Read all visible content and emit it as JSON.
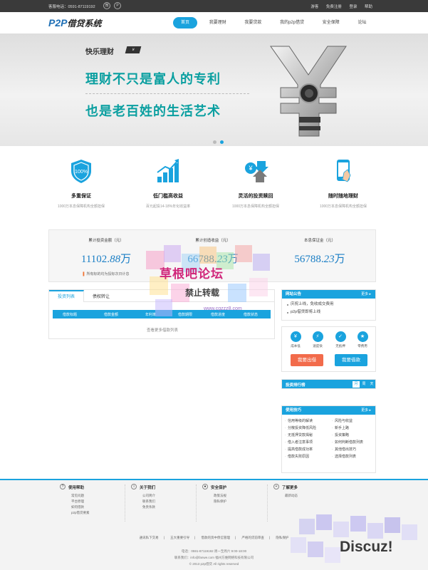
{
  "topbar": {
    "phone": "客服电话：0591-87119192",
    "social": [
      "微",
      "P"
    ],
    "links": [
      "游客",
      "免费注册",
      "登录",
      "帮助"
    ]
  },
  "nav": {
    "logo_latin": "P2P",
    "logo_cn": "借贷系统",
    "items": [
      "首页",
      "我要理财",
      "我要贷款",
      "我的p2p借贷",
      "安全保障",
      "论坛"
    ],
    "active_index": 0
  },
  "banner": {
    "tag": "快乐理财",
    "tag_badge": "¥",
    "line1": "理财不只是富人的专利",
    "line2": "也是老百姓的生活艺术",
    "slide_count": 2,
    "active_slide": 1
  },
  "features": [
    {
      "icon": "shield-icon",
      "title": "多重保证",
      "desc": "1000万本息保障机构全额担保"
    },
    {
      "icon": "bar-chart-icon",
      "title": "低门槛高收益",
      "desc": "百元起投14-18%年化收益率"
    },
    {
      "icon": "exchange-icon",
      "title": "灵活的投资赎回",
      "desc": "1000万本息保障机构全额担保"
    },
    {
      "icon": "mobile-icon",
      "title": "随时随地理财",
      "desc": "1000万本息保障机构全额担保"
    }
  ],
  "stats": [
    {
      "label": "累计投资金额（元）",
      "value": "11102.",
      "value_italic": "88",
      "unit": "万",
      "note": "所有标的均为投标次日计息"
    },
    {
      "label": "累计创造收益（元）",
      "value": "66788.",
      "value_italic": "23",
      "unit": "万",
      "note": ""
    },
    {
      "label": "本息保证金（元）",
      "value": "56788.",
      "value_italic": "23",
      "unit": "万",
      "note": ""
    }
  ],
  "loans": {
    "tabs": [
      "投资列表",
      "债权转让"
    ],
    "active_tab": 0,
    "columns": [
      "借款标题",
      "借款金额",
      "年利率",
      "借款期限",
      "借款进度",
      "借款状态"
    ],
    "more": "查看更多借款列表"
  },
  "notice": {
    "title": "网站公告",
    "more": "更多 ▸",
    "items": [
      "庆祝上线，免收成交费用",
      "p2p借贷即将上线"
    ]
  },
  "quick": {
    "items": [
      {
        "icon": "yen-icon",
        "label": "成本低"
      },
      {
        "icon": "flash-icon",
        "label": "速度快"
      },
      {
        "icon": "check-shield-icon",
        "label": "无抵押"
      },
      {
        "icon": "star-icon",
        "label": "零费用"
      }
    ],
    "lend_label": "我要出借",
    "borrow_label": "我要借款",
    "lend_color": "#f26b4b",
    "borrow_color": "#1aa3de"
  },
  "rank": {
    "title": "投资排行榜",
    "tabs": [
      "月",
      "周",
      "天"
    ],
    "active_tab": 0
  },
  "tips": {
    "title": "使用技巧",
    "more": "更多 ▸",
    "left": [
      "信用等级的解读",
      "分散投资降低风险",
      "无抵押贷款揭秘",
      "借入者注意事项",
      "提高借款成功率",
      "借款失败原因"
    ],
    "right": [
      "风险与收益",
      "新手上路",
      "投资策略",
      "如何判断借款列表",
      "其他借出技巧",
      "选择借款列表"
    ]
  },
  "footer": {
    "cols": [
      {
        "icon": "question-icon",
        "title": "使用帮助",
        "items": [
          "常见问题",
          "平台原理",
          "如何借款",
          "p2p借贷要素"
        ]
      },
      {
        "icon": "info-icon",
        "title": "关于我们",
        "items": [
          "公司简介",
          "联系我们",
          "免责条款"
        ]
      },
      {
        "icon": "lock-icon",
        "title": "安全保护",
        "items": [
          "政策法规",
          "隐私保护"
        ]
      },
      {
        "icon": "plus-icon",
        "title": "了解更多",
        "items": [
          "最新动态"
        ]
      }
    ],
    "links": [
      "通讯私下交易",
      "五大重要引导",
      "借款的资中债信管理",
      "严格的贷前审查",
      "隐私保护"
    ],
    "contact": "电话：0591-87119192 周一至周六 9:00-18:00",
    "address": "联系我们：info@fanwe.com    福州方维网络科技有限公司",
    "copyright": "© 2013 p2p借贷 All rights reserved"
  },
  "watermark": {
    "title": "草根吧论坛",
    "subtitle": "禁止转载",
    "url": "www.cgzzz8.com",
    "discuz": "Discuz!"
  },
  "colors": {
    "accent": "#1aa3de",
    "banner_text": "#0a9fa0",
    "stat_value": "#1a7ec5"
  }
}
